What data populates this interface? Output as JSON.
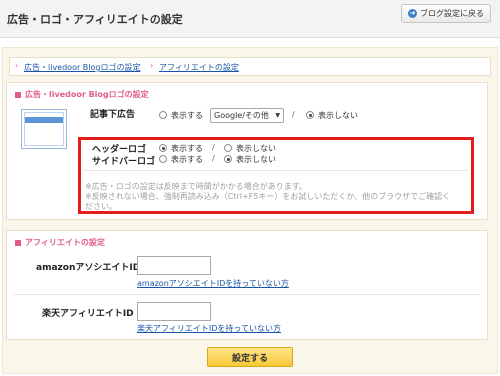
{
  "header": {
    "title": "広告・ロゴ・アフィリエイトの設定",
    "back_button": "ブログ設定に戻る"
  },
  "breadcrumb": {
    "item1": "広告・livedoor Blogロゴの設定",
    "item2": "アフィリエイトの設定"
  },
  "ad_section": {
    "title": "広告・livedoor Blogロゴの設定",
    "under_article_label": "記事下広告",
    "show": "表示する",
    "hide": "表示しない",
    "select_value": "Google/その他",
    "header_logo_label": "ヘッダーロゴ",
    "sidebar_logo_label": "サイドバーロゴ",
    "slash": "/",
    "notice_line1": "※広告・ロゴの設定は反映まで時間がかかる場合があります。",
    "notice_line2": "※反映されない場合、強制再読み込み（Ctrl+F5キー）をお試しいただくか、他のブラウザでご確認く",
    "notice_line3": "ださい。"
  },
  "affiliate_section": {
    "title": "アフィリエイトの設定",
    "amazon_label": "amazonアソシエイトID",
    "amazon_link": "amazonアソシエイトIDを持っていない方",
    "rakuten_label": "楽天アフィリエイトID",
    "rakuten_link": "楽天アフィリエイトIDを持っていない方"
  },
  "submit_label": "設定する",
  "colors": {
    "accent_pink": "#e25a8f",
    "link_blue": "#1a56a8",
    "highlight_red": "#e31c1c",
    "button_yellow": "#f7c837"
  }
}
